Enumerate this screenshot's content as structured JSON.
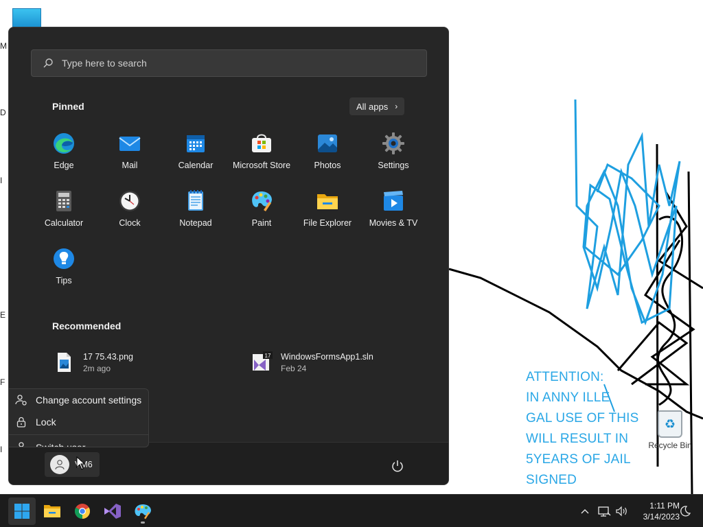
{
  "desktop": {
    "edge_letters": [
      "M",
      "D",
      "I",
      "E",
      "F",
      "I"
    ],
    "attention_lines": [
      "ATTENTION:",
      "IN ANNY ILLE",
      "GAL USE OF THIS",
      "WILL RESULT IN",
      "5YEARS OF JAIL",
      "SIGNED"
    ],
    "recycle_bin_label": "Recycle Bin"
  },
  "start_menu": {
    "search_placeholder": "Type here to search",
    "pinned_title": "Pinned",
    "all_apps_label": "All apps",
    "pinned_apps": [
      {
        "label": "Edge",
        "icon": "edge-icon"
      },
      {
        "label": "Mail",
        "icon": "mail-icon"
      },
      {
        "label": "Calendar",
        "icon": "calendar-icon"
      },
      {
        "label": "Microsoft Store",
        "icon": "store-icon"
      },
      {
        "label": "Photos",
        "icon": "photos-icon"
      },
      {
        "label": "Settings",
        "icon": "gear-icon"
      },
      {
        "label": "Calculator",
        "icon": "calculator-icon"
      },
      {
        "label": "Clock",
        "icon": "clock-icon"
      },
      {
        "label": "Notepad",
        "icon": "notepad-icon"
      },
      {
        "label": "Paint",
        "icon": "paint-icon"
      },
      {
        "label": "File Explorer",
        "icon": "folder-icon"
      },
      {
        "label": "Movies & TV",
        "icon": "movies-icon"
      },
      {
        "label": "Tips",
        "icon": "tips-icon"
      }
    ],
    "recommended_title": "Recommended",
    "recommended": [
      {
        "name": "17 75.43.png",
        "time": "2m ago",
        "icon": "image-file-icon"
      },
      {
        "name": "WindowsFormsApp1.sln",
        "time": "Feb 24",
        "icon": "vs-solution-icon",
        "badge": "17"
      }
    ],
    "account_menu": [
      {
        "label": "Change account settings",
        "icon": "account-settings-icon"
      },
      {
        "label": "Lock",
        "icon": "lock-icon"
      },
      {
        "label": "Switch user",
        "icon": "switch-user-icon"
      }
    ],
    "user_name": "VM6"
  },
  "taskbar": {
    "apps": [
      "start-icon",
      "file-explorer-icon",
      "chrome-icon",
      "visual-studio-icon",
      "paint-icon"
    ],
    "time": "1:11 PM",
    "date": "3/14/2023"
  },
  "colors": {
    "menu_bg": "#262626",
    "taskbar_bg": "#1c1c1c",
    "accent": "#0078d4",
    "attention_text": "#2aa7e6"
  }
}
